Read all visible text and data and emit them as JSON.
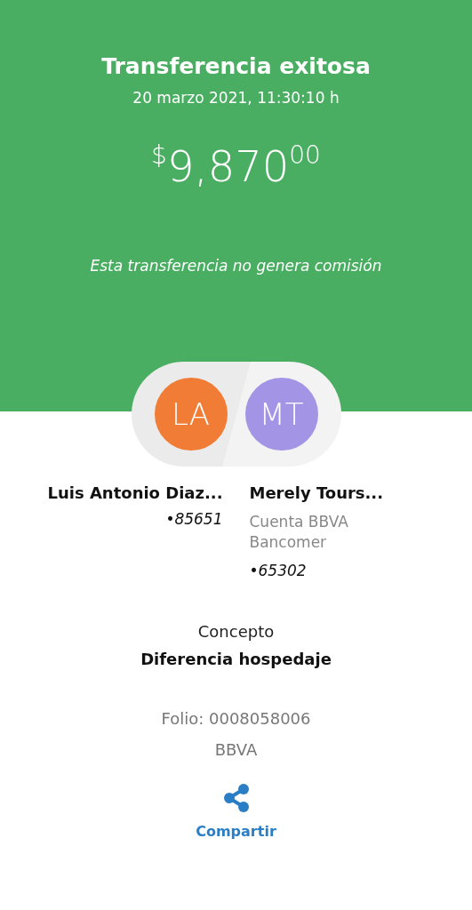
{
  "header": {
    "title": "Transferencia exitosa",
    "datetime": "20 marzo 2021, 11:30:10 h",
    "amount": {
      "currency": "$",
      "whole": "9,870",
      "cents": "00"
    },
    "note": "Esta transferencia no genera comisión"
  },
  "parties": [
    {
      "initials": "LA",
      "color": "#f07c35",
      "name": "Luis Antonio Diaz...",
      "account": "•85651"
    },
    {
      "initials": "MT",
      "color": "#a394e6",
      "name": "Merely Tours...",
      "bank": "Cuenta BBVA Bancomer",
      "account": "•65302"
    }
  ],
  "concept": {
    "label": "Concepto",
    "value": "Diferencia hospedaje"
  },
  "folio": "Folio: 0008058006",
  "bank": "BBVA",
  "share": {
    "label": "Compartir"
  }
}
